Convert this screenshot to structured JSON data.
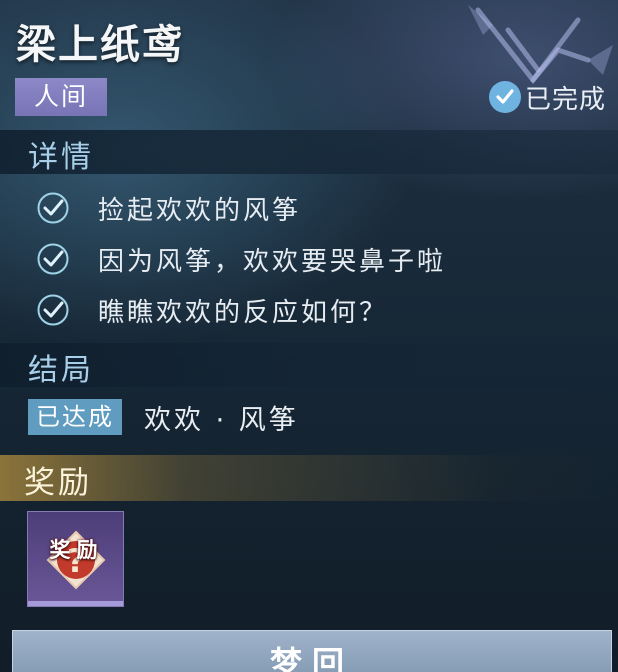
{
  "quest": {
    "title": "梁上纸鸢",
    "realm_tag": "人间",
    "status": "已完成"
  },
  "details": {
    "heading": "详情",
    "tasks": [
      {
        "text": "捡起欢欢的风筝",
        "done": true
      },
      {
        "text": "因为风筝，欢欢要哭鼻子啦",
        "done": true
      },
      {
        "text": "瞧瞧欢欢的反应如何？",
        "done": true
      }
    ]
  },
  "ending": {
    "heading": "结局",
    "badge": "已达成",
    "value": "欢欢 · 风筝"
  },
  "reward": {
    "heading": "奖励",
    "item_label": "奖励",
    "item_icon": "mystery-reward-icon"
  },
  "footer": {
    "button_label": "梦回"
  },
  "colors": {
    "realm_tag": "#7e79bb",
    "section_title": "#a8cfe9",
    "ending_badge": "#5f9cc0",
    "reward_frame": "#5a4a88",
    "check": "#9fd3e8"
  }
}
